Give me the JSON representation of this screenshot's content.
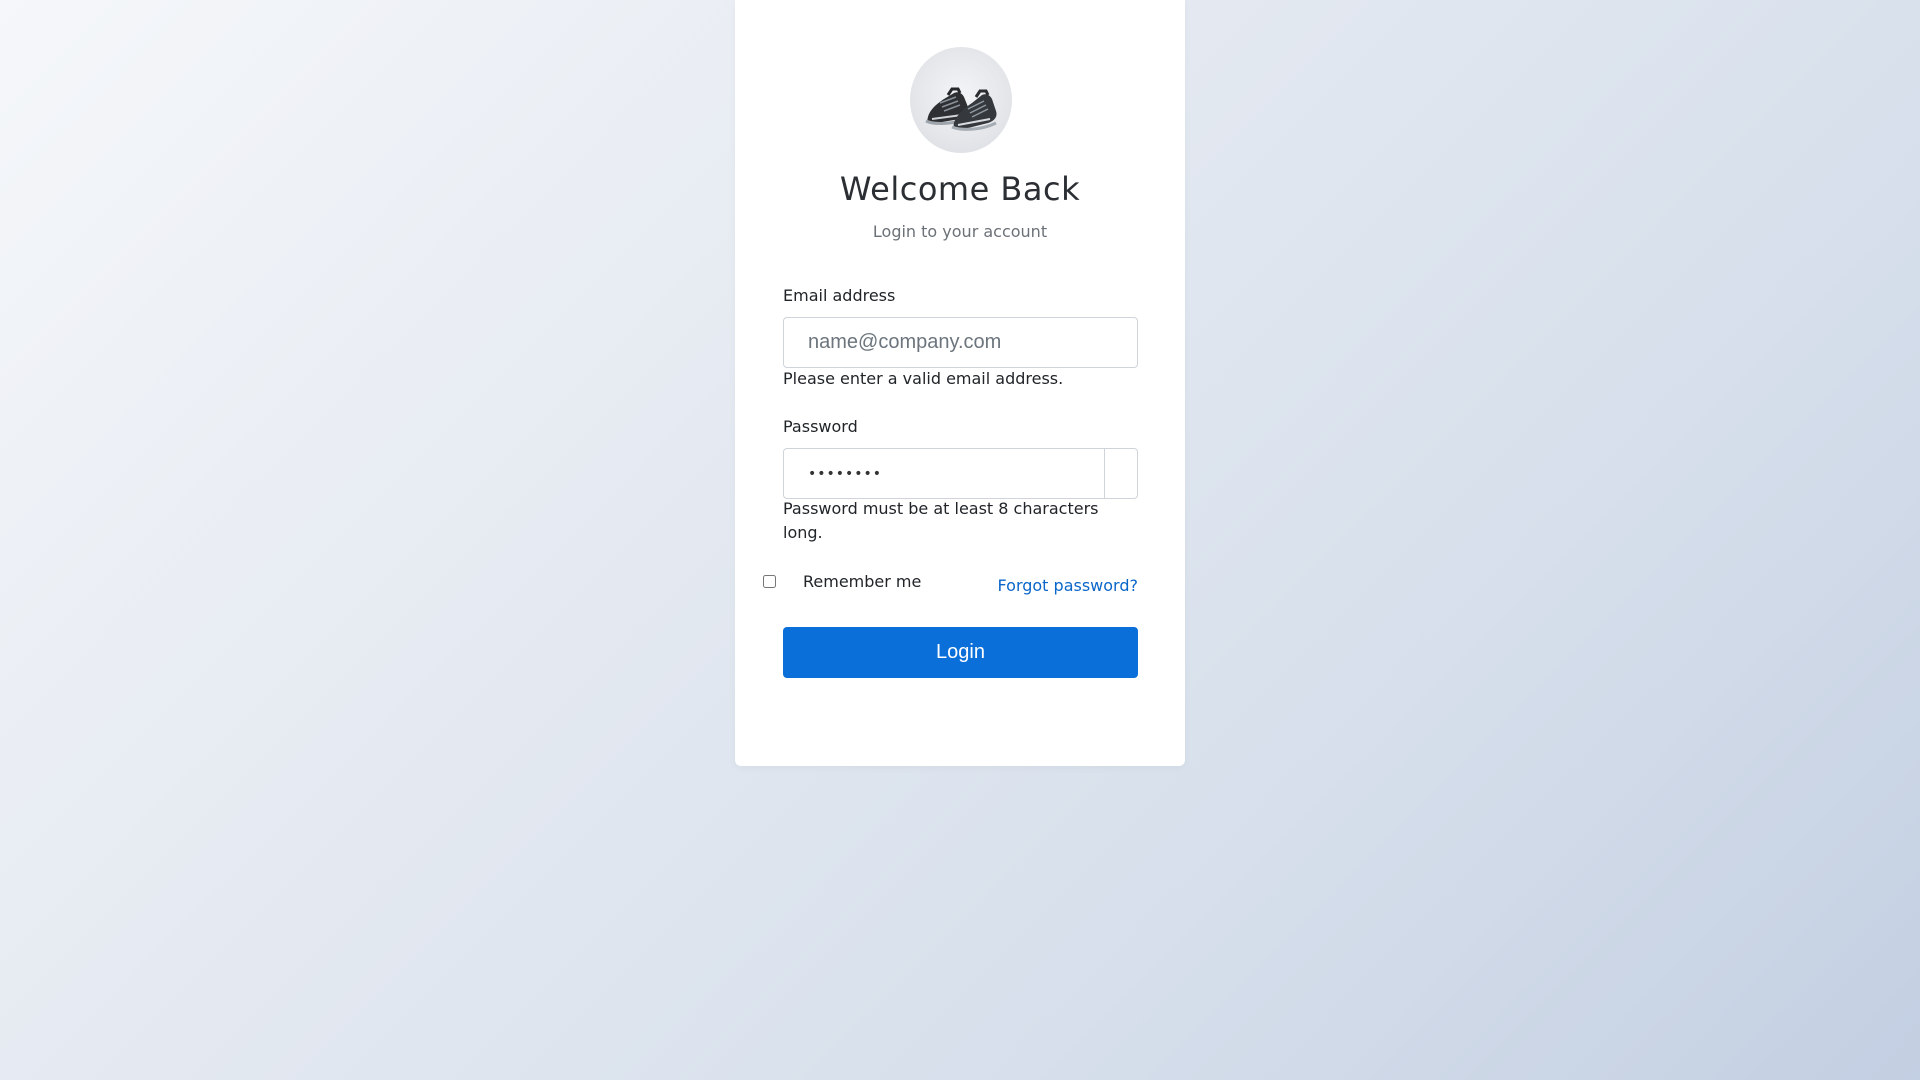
{
  "header": {
    "title": "Welcome Back",
    "subtitle": "Login to your account"
  },
  "form": {
    "email": {
      "label": "Email address",
      "placeholder": "name@company.com",
      "value": "",
      "hint": "Please enter a valid email address."
    },
    "password": {
      "label": "Password",
      "value": "••••••••",
      "hint": "Password must be at least 8 characters long."
    },
    "remember": {
      "label": "Remember me",
      "checked": false
    },
    "forgot_label": "Forgot password?",
    "submit_label": "Login"
  },
  "colors": {
    "primary": "#0a6fd8",
    "link": "#0a66c9"
  },
  "icons": {
    "avatar": "sneaker-image",
    "password_toggle": "eye-icon"
  }
}
